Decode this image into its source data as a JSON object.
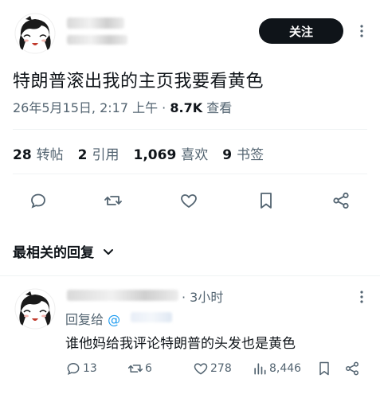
{
  "tweet": {
    "follow_label": "关注",
    "text": "特朗普滚出我的主页我要看黄色",
    "timestamp": "26年5月15日, 2:17 上午",
    "separator": " · ",
    "views_value": "8.7K",
    "views_label": " 查看"
  },
  "stats": [
    {
      "value": "28",
      "label": "转帖"
    },
    {
      "value": "2",
      "label": "引用"
    },
    {
      "value": "1,069",
      "label": "喜欢"
    },
    {
      "value": "9",
      "label": "书签"
    }
  ],
  "actions": [
    "reply-icon",
    "retweet-icon",
    "like-icon",
    "bookmark-icon",
    "share-icon"
  ],
  "sort": {
    "label": "最相关的回复"
  },
  "reply": {
    "time": "· 3小时",
    "reply_to_prefix": "回复给 ",
    "reply_to_at": "@",
    "text": "谁他妈给我评论特朗普的头发也是黄色",
    "counts": {
      "replies": "13",
      "retweets": "6",
      "likes": "278",
      "views": "8,446"
    }
  },
  "colors": {
    "accent": "#1d9bf0",
    "text": "#0f1419",
    "muted": "#536471",
    "divider": "#eff3f4"
  }
}
